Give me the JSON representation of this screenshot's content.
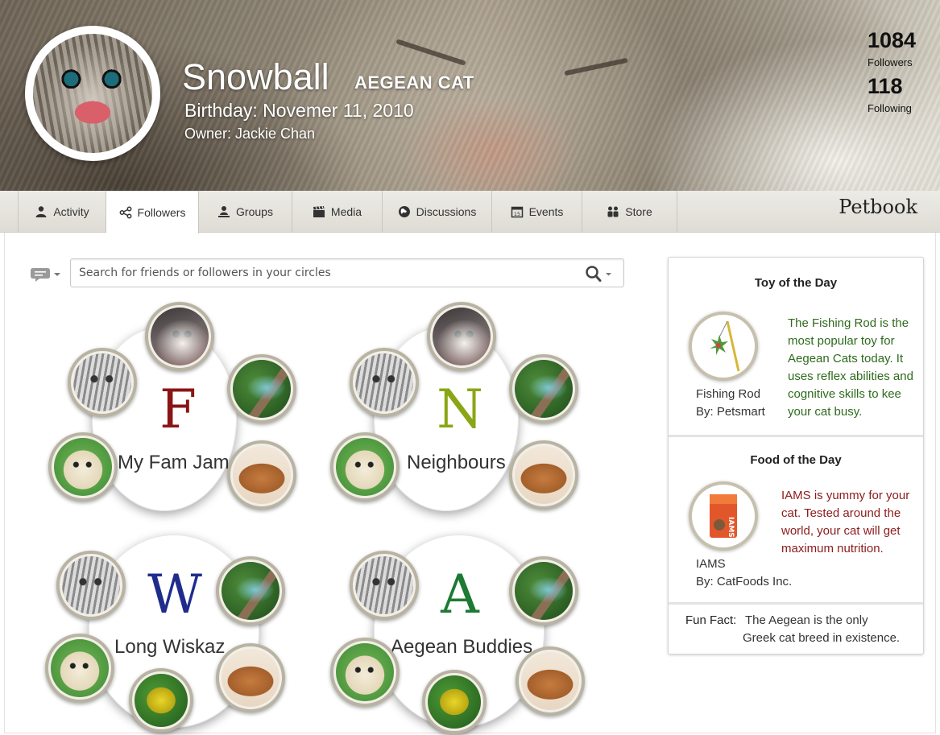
{
  "profile": {
    "name": "Snowball",
    "breed": "AEGEAN CAT",
    "birthday": "Birthday: Novemer 11, 2010",
    "owner": "Owner: Jackie Chan",
    "followers_count": "1084",
    "followers_label": "Followers",
    "following_count": "118",
    "following_label": "Following"
  },
  "nav": {
    "tabs": [
      {
        "label": "Activity",
        "icon": "person-icon"
      },
      {
        "label": "Followers",
        "icon": "share-icon",
        "active": true
      },
      {
        "label": "Groups",
        "icon": "groups-icon"
      },
      {
        "label": "Media",
        "icon": "clapperboard-icon"
      },
      {
        "label": "Discussions",
        "icon": "globe-icon"
      },
      {
        "label": "Events",
        "icon": "calendar-icon"
      },
      {
        "label": "Store",
        "icon": "people-icon"
      }
    ],
    "brand": "Petbook"
  },
  "search": {
    "placeholder": "Search for friends or followers in your circles"
  },
  "circles": [
    {
      "letter": "F",
      "label": "My Fam Jam",
      "letter_color": "#8b1414"
    },
    {
      "letter": "N",
      "label": "Neighbours",
      "letter_color": "#8aa614"
    },
    {
      "letter": "W",
      "label": "Long Wiskaz",
      "letter_color": "#1f2c8c"
    },
    {
      "letter": "A",
      "label": "Aegean Buddies",
      "letter_color": "#1c7a34"
    }
  ],
  "sidebar": {
    "toy": {
      "title": "Toy of the Day",
      "name": "Fishing Rod",
      "by": "By: Petsmart",
      "description": "The Fishing Rod is the most popular toy for Aegean Cats today. It uses reflex abilities and cognitive skills to kee your cat busy.",
      "text_color": "#2e6b1c"
    },
    "food": {
      "title": "Food of the Day",
      "name": "IAMS",
      "by": "By: CatFoods Inc.",
      "description": "IAMS is yummy for your cat. Tested around the world, your cat will get maximum nutrition.",
      "text_color": "#8c1c1c"
    },
    "fun_fact": {
      "label": "Fun Fact:",
      "text_line1": "The Aegean is the only",
      "text_line2": "Greek cat breed in existence."
    }
  }
}
